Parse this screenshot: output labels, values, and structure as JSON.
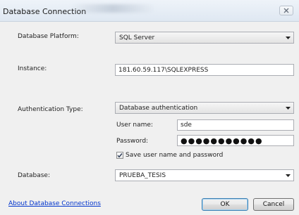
{
  "window": {
    "title": "Database Connection",
    "close_glyph": "✕"
  },
  "platform": {
    "label": "Database Platform:",
    "selected": "SQL Server"
  },
  "instance": {
    "label": "Instance:",
    "value": "181.60.59.117\\SQLEXPRESS"
  },
  "auth": {
    "label": "Authentication Type:",
    "selected": "Database authentication",
    "username_label": "User name:",
    "username_value": "sde",
    "password_label": "Password:",
    "password_value": "●●●●●●●●●●●",
    "save_label": "Save user name and password",
    "save_checked": true
  },
  "database": {
    "label": "Database:",
    "selected": "PRUEBA_TESIS"
  },
  "footer": {
    "about_link": "About Database Connections",
    "ok_label": "OK",
    "cancel_label": "Cancel"
  }
}
